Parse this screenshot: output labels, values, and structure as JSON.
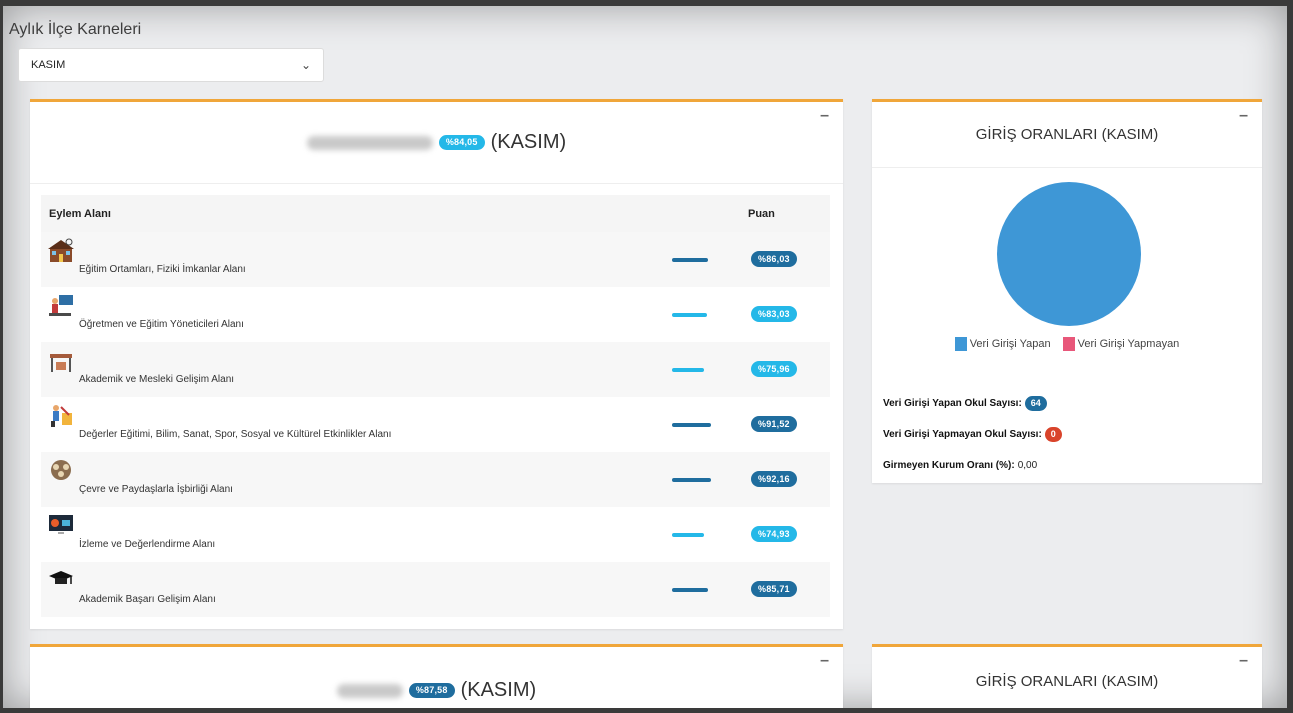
{
  "page": {
    "title": "Aylık İlçe Karneleri",
    "month_select": {
      "value": "KASIM"
    }
  },
  "main_card": {
    "score_badge": "%84,05",
    "title_suffix": "(KASIM)",
    "table": {
      "headers": {
        "area": "Eylem Alanı",
        "score": "Puan"
      },
      "rows": [
        {
          "icon": "school-building-icon",
          "label": "Eğitim Ortamları, Fiziki İmkanlar Alanı",
          "score": "%86,03",
          "progress": 0.86,
          "color": "#1f6d9e"
        },
        {
          "icon": "teacher-icon",
          "label": "Öğretmen ve Eğitim Yöneticileri Alanı",
          "score": "%83,03",
          "progress": 0.83,
          "color": "#24b8e8"
        },
        {
          "icon": "desk-icon",
          "label": "Akademik ve Mesleki Gelişim Alanı",
          "score": "%75,96",
          "progress": 0.76,
          "color": "#24b8e8"
        },
        {
          "icon": "activities-icon",
          "label": "Değerler Eğitimi, Bilim, Sanat, Spor, Sosyal ve Kültürel Etkinlikler Alanı",
          "score": "%91,52",
          "progress": 0.92,
          "color": "#1f6d9e"
        },
        {
          "icon": "partnership-icon",
          "label": "Çevre ve Paydaşlarla İşbirliği Alanı",
          "score": "%92,16",
          "progress": 0.92,
          "color": "#1f6d9e"
        },
        {
          "icon": "monitor-icon",
          "label": "İzleme ve Değerlendirme Alanı",
          "score": "%74,93",
          "progress": 0.75,
          "color": "#24b8e8"
        },
        {
          "icon": "graduation-cap-icon",
          "label": "Akademik Başarı Gelişim Alanı",
          "score": "%85,71",
          "progress": 0.86,
          "color": "#1f6d9e"
        }
      ]
    }
  },
  "side_card": {
    "title": "GİRİŞ ORANLARI (KASIM)",
    "chart_data": {
      "type": "pie",
      "categories": [
        "Veri Girişi Yapan",
        "Veri Girişi Yapmayan"
      ],
      "values": [
        64,
        0
      ],
      "colors": [
        "#3e97d6",
        "#e8577a"
      ],
      "legend": "bottom"
    },
    "stats": [
      {
        "label": "Veri Girişi Yapan Okul Sayısı:",
        "value": "64",
        "type": "badge",
        "color": "#1f6d9e"
      },
      {
        "label": "Veri Girişi Yapmayan Okul Sayısı:",
        "value": "0",
        "type": "badge",
        "color": "#d9442b"
      },
      {
        "label": "Girmeyen Kurum Oranı (%):",
        "value": "0,00",
        "type": "text"
      }
    ]
  },
  "main_card_2": {
    "score_badge": "%87,58",
    "title_suffix": "(KASIM)"
  },
  "side_card_2": {
    "title": "GİRİŞ ORANLARI (KASIM)"
  },
  "ui": {
    "collapse_symbol": "–",
    "select_chevron": "⌄"
  }
}
